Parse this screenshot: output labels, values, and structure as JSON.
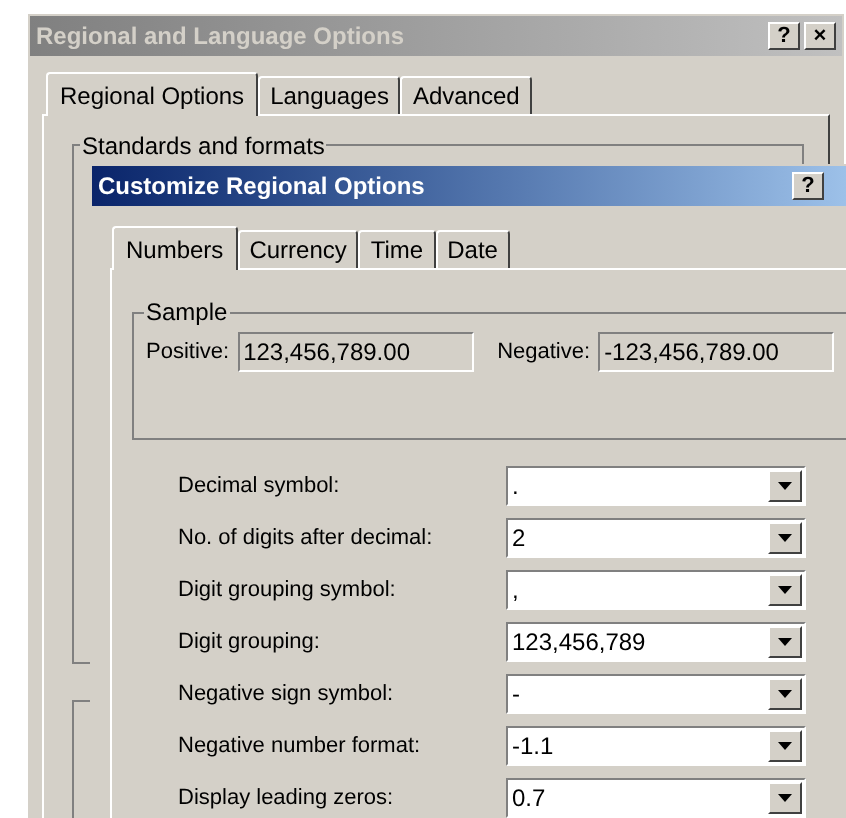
{
  "window": {
    "title": "Regional and Language Options",
    "title_buttons": [
      "?",
      "×"
    ]
  },
  "tabs": [
    {
      "label": "Regional Options",
      "selected": true
    },
    {
      "label": "Languages",
      "selected": false
    },
    {
      "label": "Advanced",
      "selected": false
    }
  ],
  "group": {
    "title": "Standards and formats"
  },
  "dialog": {
    "title": "Customize Regional Options",
    "title_buttons": [
      "?"
    ],
    "tabs": [
      {
        "label": "Numbers",
        "selected": true
      },
      {
        "label": "Currency",
        "selected": false
      },
      {
        "label": "Time",
        "selected": false
      },
      {
        "label": "Date",
        "selected": false
      }
    ],
    "sample": {
      "title": "Sample",
      "positive_label": "Positive:",
      "positive": "123,456,789.00",
      "negative_label": "Negative:",
      "negative": "-123,456,789.00"
    },
    "settings": [
      {
        "label": "Decimal symbol:",
        "value": "."
      },
      {
        "label": "No. of digits after decimal:",
        "value": "2"
      },
      {
        "label": "Digit grouping symbol:",
        "value": ","
      },
      {
        "label": "Digit grouping:",
        "value": "123,456,789"
      },
      {
        "label": "Negative sign symbol:",
        "value": "-"
      },
      {
        "label": "Negative number format:",
        "value": "-1.1"
      },
      {
        "label": "Display leading zeros:",
        "value": "0.7"
      }
    ]
  }
}
